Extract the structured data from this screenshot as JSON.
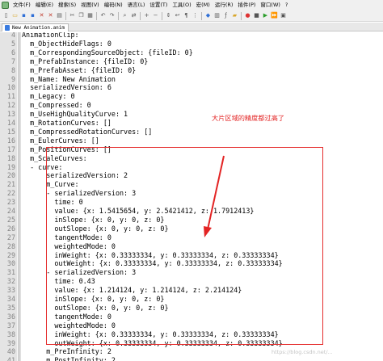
{
  "menubar": {
    "items": [
      "文件(F)",
      "编辑(E)",
      "搜索(S)",
      "视图(V)",
      "编码(N)",
      "语言(L)",
      "设置(T)",
      "工具(O)",
      "宏(M)",
      "运行(R)",
      "插件(P)",
      "窗口(W)",
      "?"
    ],
    "close_label": "X"
  },
  "toolbar": {
    "icons": [
      "new-file-icon",
      "open-file-icon",
      "save-icon",
      "save-all-icon",
      "close-icon",
      "close-all-icon",
      "print-icon",
      "cut-icon",
      "copy-icon",
      "paste-icon",
      "undo-icon",
      "redo-icon",
      "find-icon",
      "replace-icon",
      "zoom-in-icon",
      "zoom-out-icon",
      "sync-scroll-icon",
      "word-wrap-icon",
      "show-all-chars-icon",
      "indent-guide-icon",
      "language-icon",
      "doc-map-icon",
      "function-list-icon",
      "folder-workspace-icon",
      "record-macro-icon",
      "stop-record-icon",
      "play-macro-icon",
      "run-multiple-icon",
      "save-macro-icon"
    ]
  },
  "tab": {
    "label": "New Animation.anim"
  },
  "editor": {
    "lines": [
      {
        "n": "4",
        "text": "AnimationClip:"
      },
      {
        "n": "5",
        "text": "  m_ObjectHideFlags: 0"
      },
      {
        "n": "6",
        "text": "  m_CorrespondingSourceObject: {fileID: 0}"
      },
      {
        "n": "7",
        "text": "  m_PrefabInstance: {fileID: 0}"
      },
      {
        "n": "8",
        "text": "  m_PrefabAsset: {fileID: 0}"
      },
      {
        "n": "9",
        "text": "  m_Name: New Animation"
      },
      {
        "n": "10",
        "text": "  serializedVersion: 6"
      },
      {
        "n": "11",
        "text": "  m_Legacy: 0"
      },
      {
        "n": "12",
        "text": "  m_Compressed: 0"
      },
      {
        "n": "13",
        "text": "  m_UseHighQualityCurve: 1"
      },
      {
        "n": "14",
        "text": "  m_RotationCurves: []"
      },
      {
        "n": "15",
        "text": "  m_CompressedRotationCurves: []"
      },
      {
        "n": "16",
        "text": "  m_EulerCurves: []"
      },
      {
        "n": "17",
        "text": "  m_PositionCurves: []"
      },
      {
        "n": "18",
        "text": "  m_ScaleCurves:"
      },
      {
        "n": "19",
        "text": "  - curve:"
      },
      {
        "n": "20",
        "text": "      serializedVersion: 2"
      },
      {
        "n": "21",
        "text": "      m_Curve:"
      },
      {
        "n": "22",
        "text": "      - serializedVersion: 3"
      },
      {
        "n": "23",
        "text": "        time: 0"
      },
      {
        "n": "24",
        "text": "        value: {x: 1.5415654, y: 2.5421412, z: 1.7912413}"
      },
      {
        "n": "25",
        "text": "        inSlope: {x: 0, y: 0, z: 0}"
      },
      {
        "n": "26",
        "text": "        outSlope: {x: 0, y: 0, z: 0}"
      },
      {
        "n": "27",
        "text": "        tangentMode: 0"
      },
      {
        "n": "28",
        "text": "        weightedMode: 0"
      },
      {
        "n": "29",
        "text": "        inWeight: {x: 0.33333334, y: 0.33333334, z: 0.33333334}"
      },
      {
        "n": "30",
        "text": "        outWeight: {x: 0.33333334, y: 0.33333334, z: 0.33333334}"
      },
      {
        "n": "31",
        "text": "      - serializedVersion: 3"
      },
      {
        "n": "32",
        "text": "        time: 0.43"
      },
      {
        "n": "33",
        "text": "        value: {x: 1.214124, y: 1.214124, z: 2.214124}"
      },
      {
        "n": "34",
        "text": "        inSlope: {x: 0, y: 0, z: 0}"
      },
      {
        "n": "35",
        "text": "        outSlope: {x: 0, y: 0, z: 0}"
      },
      {
        "n": "36",
        "text": "        tangentMode: 0"
      },
      {
        "n": "37",
        "text": "        weightedMode: 0"
      },
      {
        "n": "38",
        "text": "        inWeight: {x: 0.33333334, y: 0.33333334, z: 0.33333334}"
      },
      {
        "n": "39",
        "text": "        outWeight: {x: 0.33333334, y: 0.33333334, z: 0.33333334}"
      },
      {
        "n": "40",
        "text": "      m_PreInfinity: 2"
      },
      {
        "n": "41",
        "text": "      m_PostInfinity: 2"
      }
    ]
  },
  "annotation": {
    "text": "大片区域的精度都过高了",
    "color": "#e32424"
  },
  "watermark": "https://blog.csdn.net/..."
}
